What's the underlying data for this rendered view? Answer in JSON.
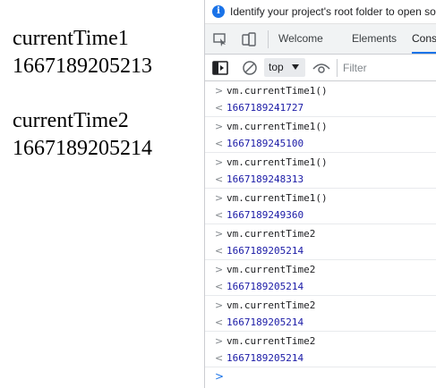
{
  "page": {
    "block1": {
      "label": "currentTime1",
      "value": "1667189205213"
    },
    "block2": {
      "label": "currentTime2",
      "value": "1667189205214"
    }
  },
  "devtools": {
    "info_bar": {
      "text": "Identify your project's root folder to open source"
    },
    "tabs": [
      {
        "label": "Welcome"
      },
      {
        "label": "Elements"
      },
      {
        "label": "Console"
      }
    ],
    "toolbar": {
      "context": "top",
      "filter_placeholder": "Filter"
    },
    "console_entries": [
      {
        "command": "vm.currentTime1()",
        "result": "1667189241727"
      },
      {
        "command": "vm.currentTime1()",
        "result": "1667189245100"
      },
      {
        "command": "vm.currentTime1()",
        "result": "1667189248313"
      },
      {
        "command": "vm.currentTime1()",
        "result": "1667189249360"
      },
      {
        "command": "vm.currentTime2",
        "result": "1667189205214"
      },
      {
        "command": "vm.currentTime2",
        "result": "1667189205214"
      },
      {
        "command": "vm.currentTime2",
        "result": "1667189205214"
      },
      {
        "command": "vm.currentTime2",
        "result": "1667189205214"
      }
    ],
    "glyphs": {
      "input_arrow": ">",
      "output_arrow": "<",
      "prompt": ">"
    }
  },
  "colors": {
    "accent": "#1a73e8",
    "result_text": "#1a1aa6",
    "panel_border": "#cbcdd1"
  },
  "icons": {
    "info": "info-icon",
    "inspect": "inspect-element-icon",
    "device": "device-toolbar-icon",
    "sidebar": "console-sidebar-icon",
    "clear": "clear-console-icon",
    "context_caret": "caret-down-icon",
    "live_expression": "eye-icon"
  }
}
